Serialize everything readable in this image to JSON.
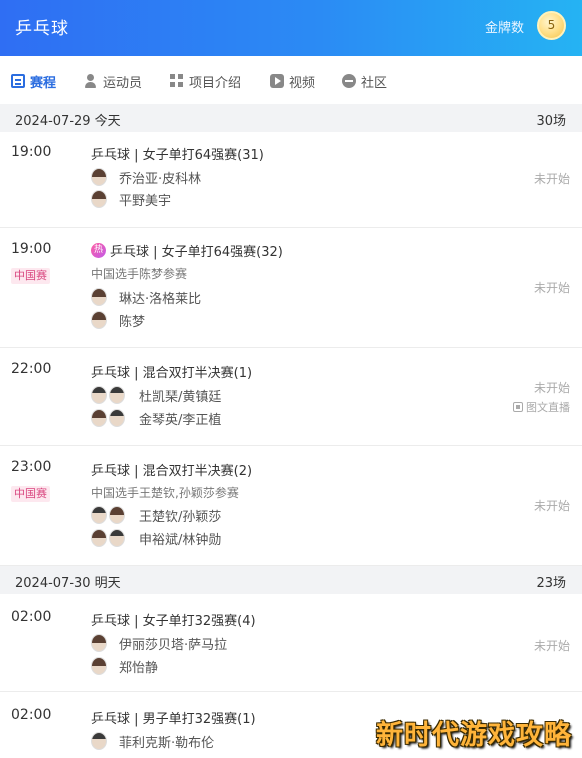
{
  "app": {
    "title": "乒乓球",
    "gold_label": "金牌数",
    "gold_count": "5"
  },
  "tabs": [
    {
      "label": "赛程",
      "icon": "calendar-icon",
      "active": true
    },
    {
      "label": "运动员",
      "icon": "user-icon",
      "active": false
    },
    {
      "label": "项目介绍",
      "icon": "grid-icon",
      "active": false
    },
    {
      "label": "视频",
      "icon": "play-icon",
      "active": false
    },
    {
      "label": "社区",
      "icon": "chat-icon",
      "active": false
    }
  ],
  "days": [
    {
      "label": "2024-07-29 今天",
      "count": "30场",
      "matches": [
        {
          "time": "19:00",
          "title": "乒乓球 | 女子单打64强赛(31)",
          "players": [
            "乔治亚·皮科林",
            "平野美宇"
          ],
          "status": "未开始"
        },
        {
          "time": "19:00",
          "badge": "中国赛",
          "title": "乒乓球 | 女子单打64强赛(32)",
          "note": "中国选手陈梦参赛",
          "players": [
            "琳达·洛格莱比",
            "陈梦"
          ],
          "status": "未开始"
        },
        {
          "time": "22:00",
          "title": "乒乓球 | 混合双打半决赛(1)",
          "players": [
            "杜凯琹/黄镇廷",
            "金琴英/李正植"
          ],
          "status": "未开始",
          "live": "图文直播"
        },
        {
          "time": "23:00",
          "badge": "中国赛",
          "title": "乒乓球 | 混合双打半决赛(2)",
          "note": "中国选手王楚钦,孙颖莎参赛",
          "players": [
            "王楚钦/孙颖莎",
            "申裕斌/林钟勋"
          ],
          "status": "未开始"
        }
      ]
    },
    {
      "label": "2024-07-30 明天",
      "count": "23场",
      "matches": [
        {
          "time": "02:00",
          "title": "乒乓球 | 女子单打32强赛(4)",
          "players": [
            "伊丽莎贝塔·萨马拉",
            "郑怡静"
          ],
          "status": "未开始"
        },
        {
          "time": "02:00",
          "title": "乒乓球 | 男子单打32强赛(1)",
          "players": [
            "菲利克斯·勒布伦"
          ]
        }
      ]
    }
  ],
  "watermark": "新时代游戏攻略"
}
